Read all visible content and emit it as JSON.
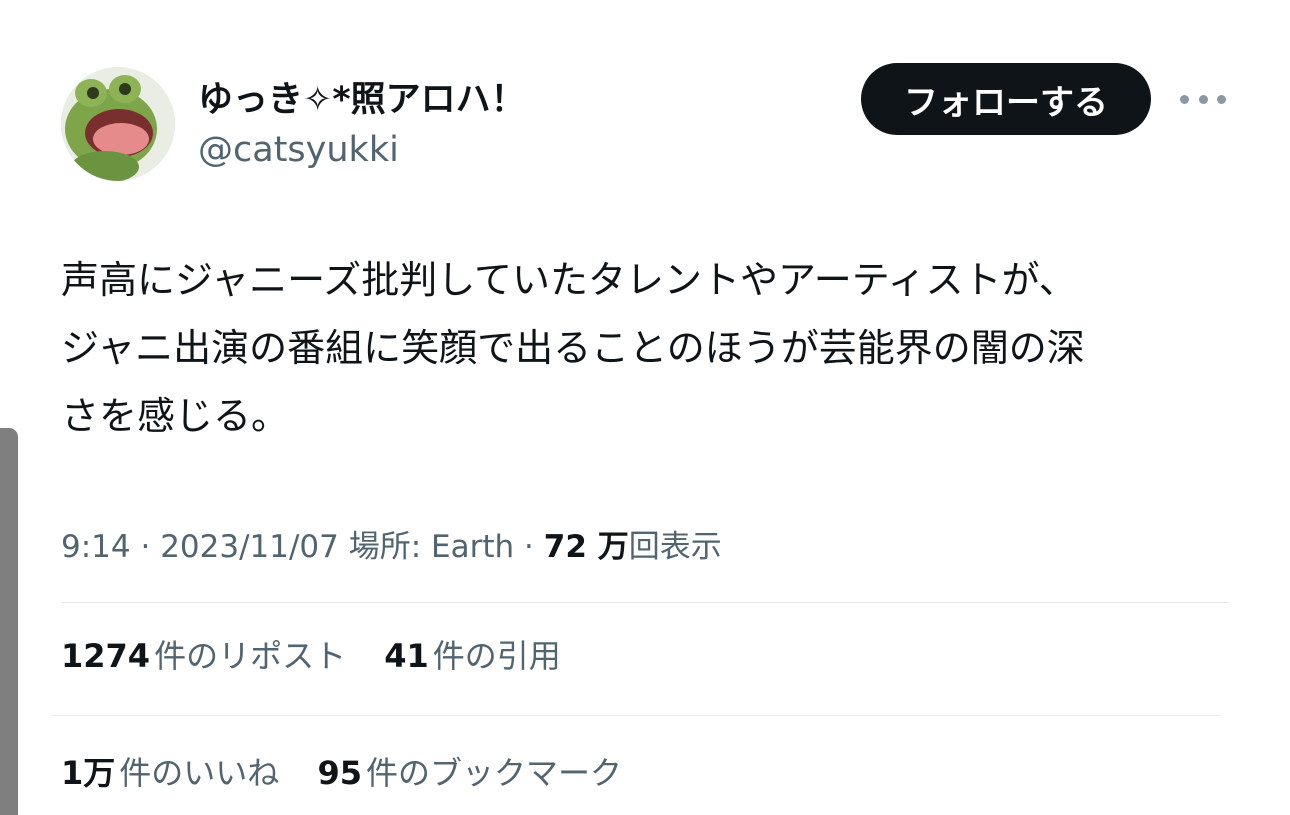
{
  "author": {
    "display_name": "ゆっき✧*照アロハ！",
    "handle": "@catsyukki",
    "avatar_icon": "frog-plush-avatar"
  },
  "follow_button": {
    "label": "フォローする"
  },
  "more_button": {
    "icon": "more-dots-icon"
  },
  "tweet": {
    "text": "声高にジャニーズ批判していたタレントやアーティストが、\nジャニ出演の番組に笑顔で出ることのほうが芸能界の闇の深\nさを感じる。"
  },
  "meta": {
    "time": "9:14",
    "sep1": "·",
    "date": "2023/11/07",
    "location_label": "場所: Earth",
    "sep2": "·",
    "views_count": "72 万",
    "views_label": "回表示"
  },
  "stats": {
    "reposts": {
      "count": "1274",
      "label": "件のリポスト"
    },
    "quotes": {
      "count": "41",
      "label": "件の引用"
    },
    "likes": {
      "count": "1万",
      "label": "件のいいね"
    },
    "bookmarks": {
      "count": "95",
      "label": "件のブックマーク"
    }
  },
  "colors": {
    "text_primary": "#0f1419",
    "text_secondary": "#536471",
    "button_bg": "#0f1419",
    "divider": "#e1e8ed"
  }
}
